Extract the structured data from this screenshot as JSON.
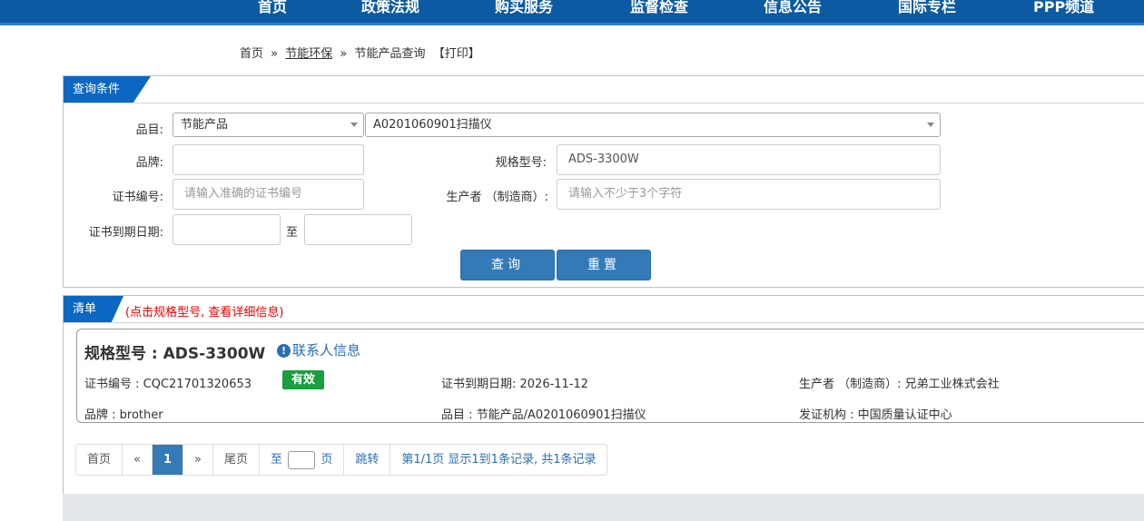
{
  "nav": {
    "items": [
      "首页",
      "政策法规",
      "购买服务",
      "监督检查",
      "信息公告",
      "国际专栏",
      "PPP频道"
    ]
  },
  "breadcrumb": {
    "home": "首页",
    "sep1": "»",
    "section": "节能环保",
    "sep2": "»",
    "current": "节能产品查询",
    "print": "【打印】"
  },
  "query": {
    "title": "查询条件",
    "category_label": "品目:",
    "category_value": "节能产品",
    "subcategory_value": "A0201060901扫描仪",
    "brand_label": "品牌:",
    "brand_value": "",
    "model_label": "规格型号:",
    "model_value": "ADS-3300W",
    "cert_label": "证书编号:",
    "cert_placeholder": "请输入准确的证书编号",
    "maker_label": "生产者 （制造商）:",
    "maker_placeholder": "请输入不少于3个字符",
    "expiry_label": "证书到期日期:",
    "expiry_to": "至",
    "search_button": "查询",
    "reset_button": "重置"
  },
  "results": {
    "title": "清单",
    "hint": "(点击规格型号, 查看详细信息)",
    "item": {
      "model": "规格型号 : ADS-3300W",
      "contact": "联系人信息",
      "cert_no": "证书编号 : CQC21701320653",
      "status": "有效",
      "expiry": "证书到期日期: 2026-11-12",
      "maker": "生产者 （制造商）: 兄弟工业株式会社",
      "brand": "品牌 : brother",
      "category": "品目 : 节能产品/A0201060901扫描仪",
      "issuer": "发证机构 : 中国质量认证中心"
    }
  },
  "pager": {
    "first": "首页",
    "prev": "«",
    "page": "1",
    "next": "»",
    "last": "尾页",
    "to": "至",
    "page_unit": "页",
    "jump": "跳转",
    "summary": "第1/1页  显示1到1条记录, 共1条记录"
  },
  "colors": {
    "nav_bg": "#0b5aa2",
    "tab_bg": "#0b67c2",
    "button_bg": "#337ab7",
    "badge_bg": "#1a9e3e",
    "hint": "#ee0000"
  }
}
